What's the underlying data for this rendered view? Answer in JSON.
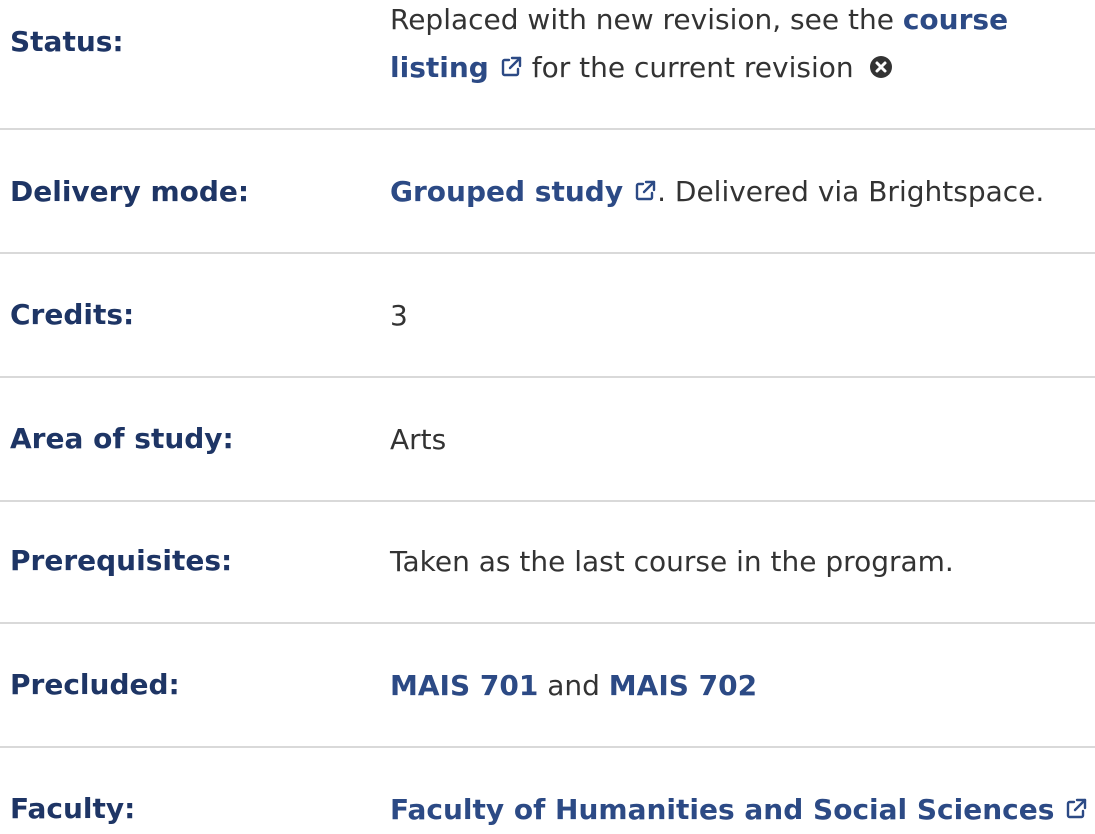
{
  "rows": {
    "status": {
      "label": "Status:",
      "text_before": "Replaced with new revision, see the ",
      "link": "course listing",
      "text_after": " for the current revision "
    },
    "delivery": {
      "label": "Delivery mode:",
      "link": "Grouped study",
      "text_after": ". Delivered via Brightspace."
    },
    "credits": {
      "label": "Credits:",
      "value": "3"
    },
    "area": {
      "label": "Area of study:",
      "value": "Arts"
    },
    "prerequisites": {
      "label": "Prerequisites:",
      "value": "Taken as the last course in the program."
    },
    "precluded": {
      "label": "Precluded:",
      "link1": "MAIS 701",
      "connector": " and ",
      "link2": "MAIS 702"
    },
    "faculty": {
      "label": "Faculty:",
      "link": "Faculty of Humanities and Social Sciences"
    }
  },
  "colors": {
    "label": "#1e3565",
    "link": "#2c4a85",
    "text": "#333333",
    "divider": "#d9d9d9"
  },
  "icons": {
    "external": "external-link-icon",
    "close": "close-circle-icon"
  }
}
